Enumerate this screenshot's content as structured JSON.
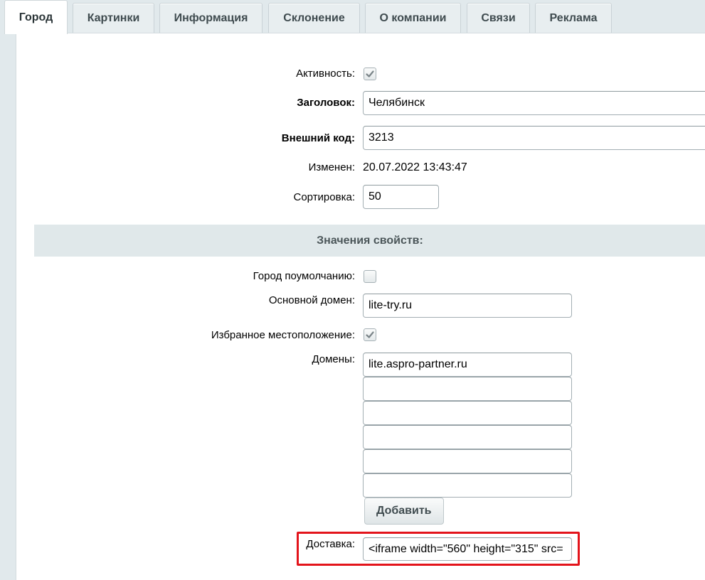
{
  "tabs": [
    {
      "label": "Город",
      "active": true
    },
    {
      "label": "Картинки"
    },
    {
      "label": "Информация"
    },
    {
      "label": "Склонение"
    },
    {
      "label": "О компании"
    },
    {
      "label": "Связи"
    },
    {
      "label": "Реклама"
    }
  ],
  "form": {
    "active_label": "Активность:",
    "active_checked": true,
    "title_label": "Заголовок:",
    "title_value": "Челябинск",
    "external_code_label": "Внешний код:",
    "external_code_value": "3213",
    "modified_label": "Изменен:",
    "modified_value": "20.07.2022 13:43:47",
    "sort_label": "Сортировка:",
    "sort_value": "50"
  },
  "properties": {
    "section_title": "Значения свойств:",
    "default_city_label": "Город поумолчанию:",
    "default_city_checked": false,
    "main_domain_label": "Основной домен:",
    "main_domain_value": "lite-try.ru",
    "favorite_location_label": "Избранное местоположение:",
    "favorite_location_checked": true,
    "domains_label": "Домены:",
    "domains": [
      "lite.aspro-partner.ru",
      "",
      "",
      "",
      "",
      ""
    ],
    "add_button_label": "Добавить",
    "delivery_label": "Доставка:",
    "delivery_value": "<iframe width=\"560\" height=\"315\" src="
  },
  "colors": {
    "highlight": "#e3141b",
    "section_bg": "#e0e8ea",
    "page_bg": "#e1e9ec"
  }
}
